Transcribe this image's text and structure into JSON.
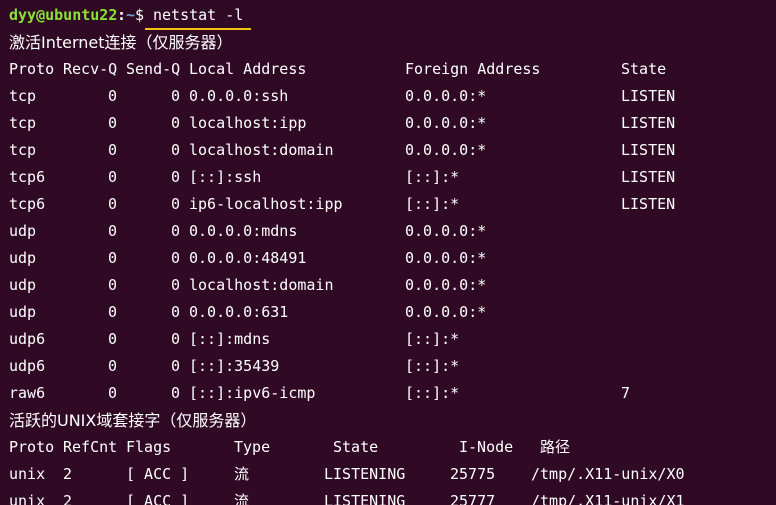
{
  "prompt": {
    "user_host": "dyy@ubuntu22",
    "separator": ":",
    "path": "~",
    "dollar": "$",
    "command": "netstat -l"
  },
  "inet_section": {
    "heading": "激活Internet连接（仅服务器）",
    "columns": {
      "proto": "Proto",
      "recvq": "Recv-Q",
      "sendq": "Send-Q",
      "local": "Local Address",
      "foreign": "Foreign Address",
      "state": "State"
    },
    "rows": [
      {
        "proto": "tcp",
        "recvq": "0",
        "sendq": "0",
        "local": "0.0.0.0:ssh",
        "foreign": "0.0.0.0:*",
        "state": "LISTEN"
      },
      {
        "proto": "tcp",
        "recvq": "0",
        "sendq": "0",
        "local": "localhost:ipp",
        "foreign": "0.0.0.0:*",
        "state": "LISTEN"
      },
      {
        "proto": "tcp",
        "recvq": "0",
        "sendq": "0",
        "local": "localhost:domain",
        "foreign": "0.0.0.0:*",
        "state": "LISTEN"
      },
      {
        "proto": "tcp6",
        "recvq": "0",
        "sendq": "0",
        "local": "[::]:ssh",
        "foreign": "[::]:*",
        "state": "LISTEN"
      },
      {
        "proto": "tcp6",
        "recvq": "0",
        "sendq": "0",
        "local": "ip6-localhost:ipp",
        "foreign": "[::]:*",
        "state": "LISTEN"
      },
      {
        "proto": "udp",
        "recvq": "0",
        "sendq": "0",
        "local": "0.0.0.0:mdns",
        "foreign": "0.0.0.0:*",
        "state": ""
      },
      {
        "proto": "udp",
        "recvq": "0",
        "sendq": "0",
        "local": "0.0.0.0:48491",
        "foreign": "0.0.0.0:*",
        "state": ""
      },
      {
        "proto": "udp",
        "recvq": "0",
        "sendq": "0",
        "local": "localhost:domain",
        "foreign": "0.0.0.0:*",
        "state": ""
      },
      {
        "proto": "udp",
        "recvq": "0",
        "sendq": "0",
        "local": "0.0.0.0:631",
        "foreign": "0.0.0.0:*",
        "state": ""
      },
      {
        "proto": "udp6",
        "recvq": "0",
        "sendq": "0",
        "local": "[::]:mdns",
        "foreign": "[::]:*",
        "state": ""
      },
      {
        "proto": "udp6",
        "recvq": "0",
        "sendq": "0",
        "local": "[::]:35439",
        "foreign": "[::]:*",
        "state": ""
      },
      {
        "proto": "raw6",
        "recvq": "0",
        "sendq": "0",
        "local": "[::]:ipv6-icmp",
        "foreign": "[::]:*",
        "state": "7"
      }
    ]
  },
  "unix_section": {
    "heading": "活跃的UNIX域套接字（仅服务器）",
    "columns": {
      "proto": "Proto",
      "refcnt": "RefCnt",
      "flags": "Flags",
      "type": "Type",
      "state": "State",
      "inode": "I-Node",
      "path": "路径"
    },
    "rows": [
      {
        "proto": "unix",
        "refcnt": "2",
        "flags": "[ ACC ]",
        "type": "流",
        "state": "LISTENING",
        "inode": "25775",
        "path": "/tmp/.X11-unix/X0"
      },
      {
        "proto": "unix",
        "refcnt": "2",
        "flags": "[ ACC ]",
        "type": "流",
        "state": "LISTENING",
        "inode": "25777",
        "path": "/tmp/.X11-unix/X1"
      }
    ]
  }
}
